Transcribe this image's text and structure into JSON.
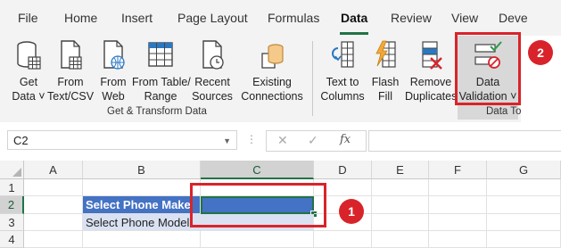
{
  "tabs": [
    "File",
    "Home",
    "Insert",
    "Page Layout",
    "Formulas",
    "Data",
    "Review",
    "View",
    "Deve"
  ],
  "ribbon": {
    "get_transform": {
      "buttons": [
        {
          "l1": "Get",
          "l2": "Data ˅"
        },
        {
          "l1": "From",
          "l2": "Text/CSV"
        },
        {
          "l1": "From",
          "l2": "Web"
        },
        {
          "l1": "From Table/",
          "l2": "Range"
        },
        {
          "l1": "Recent",
          "l2": "Sources"
        },
        {
          "l1": "Existing",
          "l2": "Connections"
        }
      ],
      "label": "Get & Transform Data"
    },
    "data_tools": {
      "buttons": [
        {
          "l1": "Text to",
          "l2": "Columns"
        },
        {
          "l1": "Flash",
          "l2": "Fill"
        },
        {
          "l1": "Remove",
          "l2": "Duplicates"
        },
        {
          "l1": "Data",
          "l2": "Validation ˅"
        }
      ],
      "label": "Data To"
    }
  },
  "formula_bar": {
    "name_box": "C2",
    "fx": "fx",
    "cancel": "✕",
    "enter": "✓",
    "value": ""
  },
  "grid": {
    "columns": [
      "A",
      "B",
      "C",
      "D",
      "E",
      "F",
      "G"
    ],
    "rows": [
      "1",
      "2",
      "3",
      "4"
    ],
    "b2": "Select Phone Make",
    "b3": "Select Phone Model"
  },
  "annotations": {
    "c1": "1",
    "c2": "2"
  },
  "colors": {
    "accent": "#217346",
    "annotation_red": "#d9232a",
    "header_fill": "#4472c4",
    "light_fill": "#d9e1f2"
  }
}
